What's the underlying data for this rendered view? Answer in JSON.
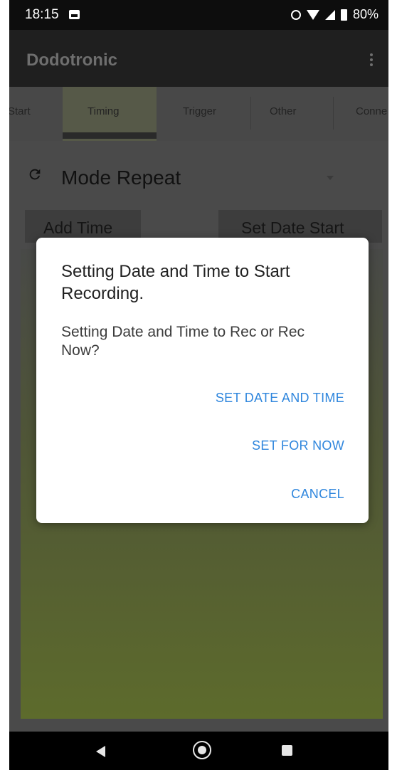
{
  "status_bar": {
    "time": "18:15",
    "battery": "80%"
  },
  "app_bar": {
    "title": "Dodotronic"
  },
  "tabs": [
    {
      "label": "Start"
    },
    {
      "label": "Timing",
      "selected": true
    },
    {
      "label": "Trigger"
    },
    {
      "label": "Other"
    },
    {
      "label": "Conne"
    }
  ],
  "content": {
    "mode": "Mode Repeat",
    "add_time_label": "Add Time",
    "set_date_start_label": "Set Date Start"
  },
  "dialog": {
    "title": "Setting Date and Time to Start Recording.",
    "message": "Setting Date and Time to Rec or Rec Now?",
    "actions": [
      {
        "label": "SET DATE AND TIME"
      },
      {
        "label": "SET FOR NOW"
      },
      {
        "label": "CANCEL"
      }
    ]
  },
  "colors": {
    "accent": "#2f86dd",
    "scrim": "#4a4a4a",
    "dialog_bg": "#ffffff"
  }
}
